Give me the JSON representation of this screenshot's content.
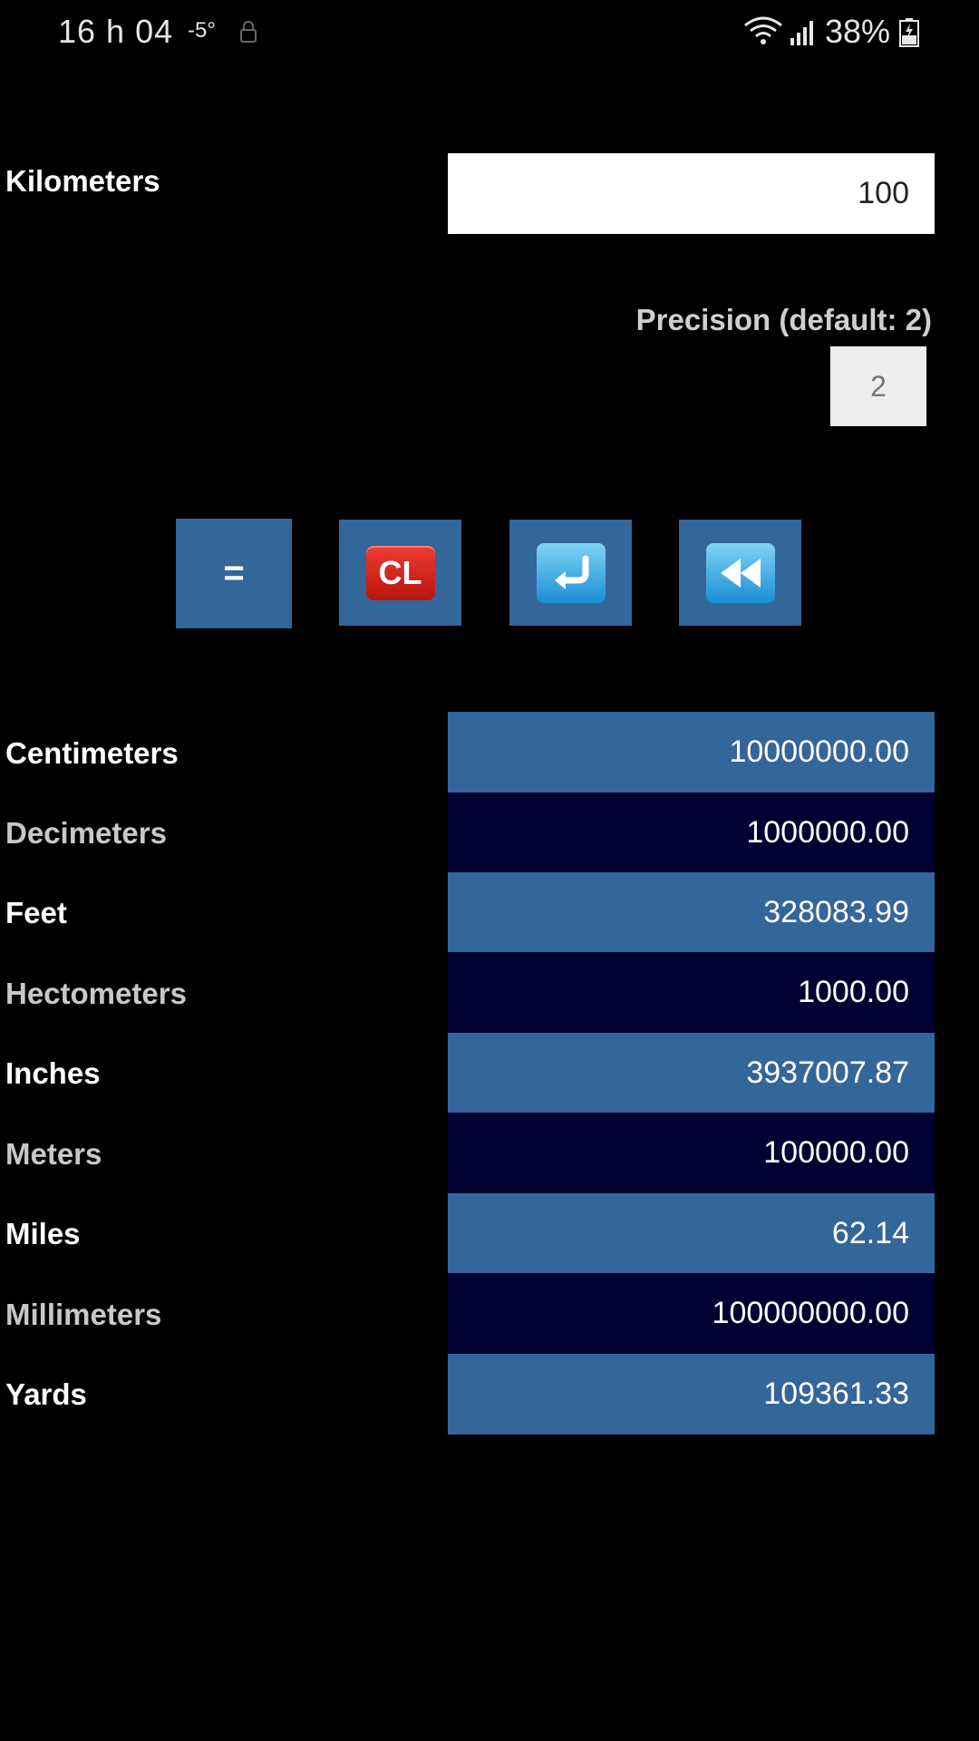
{
  "status_bar": {
    "time": "16 h 04",
    "temperature": "-5°",
    "battery": "38%"
  },
  "input": {
    "unit_label": "Kilometers",
    "value": "100"
  },
  "precision": {
    "label": "Precision (default: 2)",
    "value": "2"
  },
  "buttons": {
    "equals_label": "=",
    "clear_label": "CL"
  },
  "results": [
    {
      "unit": "Centimeters",
      "value": "10000000.00"
    },
    {
      "unit": "Decimeters",
      "value": "1000000.00"
    },
    {
      "unit": "Feet",
      "value": "328083.99"
    },
    {
      "unit": "Hectometers",
      "value": "1000.00"
    },
    {
      "unit": "Inches",
      "value": "3937007.87"
    },
    {
      "unit": "Meters",
      "value": "100000.00"
    },
    {
      "unit": "Miles",
      "value": "62.14"
    },
    {
      "unit": "Millimeters",
      "value": "100000000.00"
    },
    {
      "unit": "Yards",
      "value": "109361.33"
    }
  ],
  "colors": {
    "row_light": "#336699",
    "row_dark": "#000033",
    "button_bg": "#336699"
  }
}
